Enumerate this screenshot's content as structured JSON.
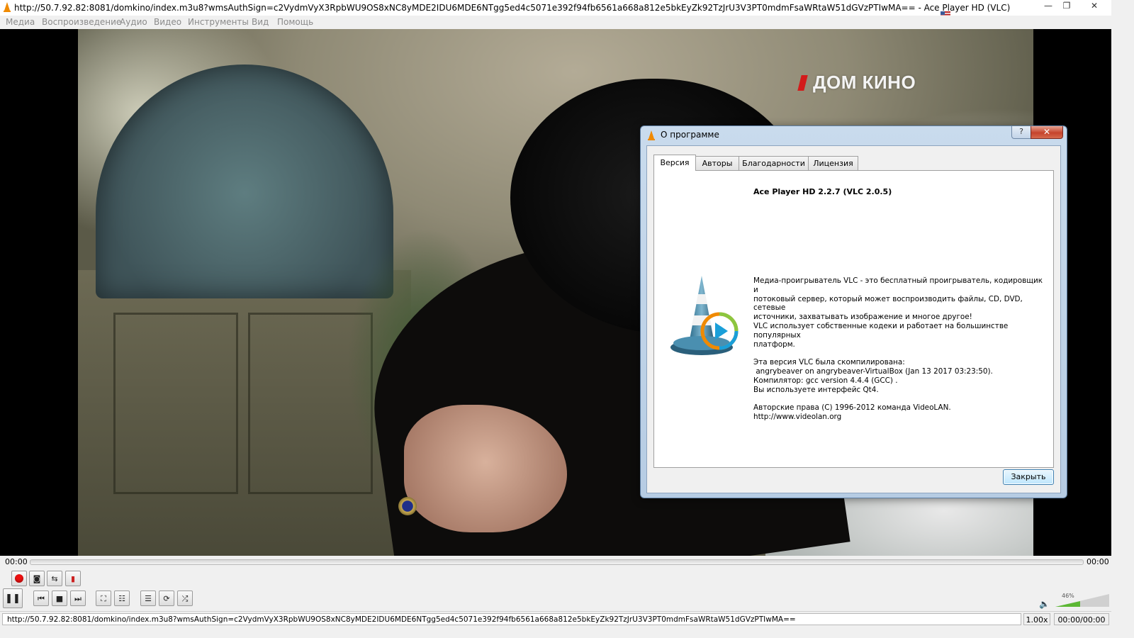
{
  "window": {
    "title": "http://50.7.92.82:8081/domkino/index.m3u8?wmsAuthSign=c2VydmVyX3RpbWU9OS8xNC8yMDE2IDU6MDE6NTgg5ed4c5071e392f94fb6561a668a812e5bkEyZk92TzJrU3V3PT0mdmFsaWRtaW51dGVzPTIwMA== - Ace Player HD (VLC)",
    "minimize": "—",
    "maximize": "❐",
    "close": "✕"
  },
  "menu": [
    "Медиа",
    "Воспроизведение",
    "Аудио",
    "Видео",
    "Инструменты",
    "Вид",
    "Помощь"
  ],
  "video": {
    "channel_logo": "ДОМ КИНО"
  },
  "dialog": {
    "title": "О программе",
    "help_label": "?",
    "close_label": "✕",
    "tabs": [
      "Версия",
      "Авторы",
      "Благодарности",
      "Лицензия"
    ],
    "active_tab": 0,
    "app_version": "Ace Player HD 2.2.7 (VLC 2.0.5)",
    "description": [
      "Медиа-проигрыватель VLC - это бесплатный проигрыватель, кодировщик и",
      "потоковый сервер, который может воспроизводить файлы, CD, DVD, сетевые",
      "источники, захватывать изображение и многое другое!",
      "VLC использует собственные кодеки и работает на большинстве популярных",
      "платформ."
    ],
    "build_info": [
      "Эта версия VLC была скомпилирована:",
      " angrybeaver on angrybeaver-VirtualBox (Jan 13 2017 03:23:50).",
      "Компилятор: gcc version 4.4.4 (GCC) .",
      "Вы используете интерфейс Qt4."
    ],
    "copyright": "Авторские права (C) 1996-2012 команда VideoLAN.",
    "website": "http://www.videolan.org",
    "close_button": "Закрыть"
  },
  "player": {
    "time_elapsed": "00:00",
    "time_total": "00:00",
    "volume_percent": "46%",
    "volume_level": 0.46,
    "status_url": "http://50.7.92.82:8081/domkino/index.m3u8?wmsAuthSign=c2VydmVyX3RpbWU9OS8xNC8yMDE2IDU6MDE6NTgg5ed4c5071e392f94fb6561a668a812e5bkEyZk92TzJrU3V3PT0mdmFsaWRtaW51dGVzPTIwMA==",
    "speed": "1.00x",
    "status_time": "00:00/00:00"
  },
  "colors": {
    "dialog_frame": "#b6cce3",
    "close_button_red": "#c5432c",
    "record_red": "#e11111",
    "volume_green": "#5cb834",
    "vlc_orange": "#f08a00"
  }
}
